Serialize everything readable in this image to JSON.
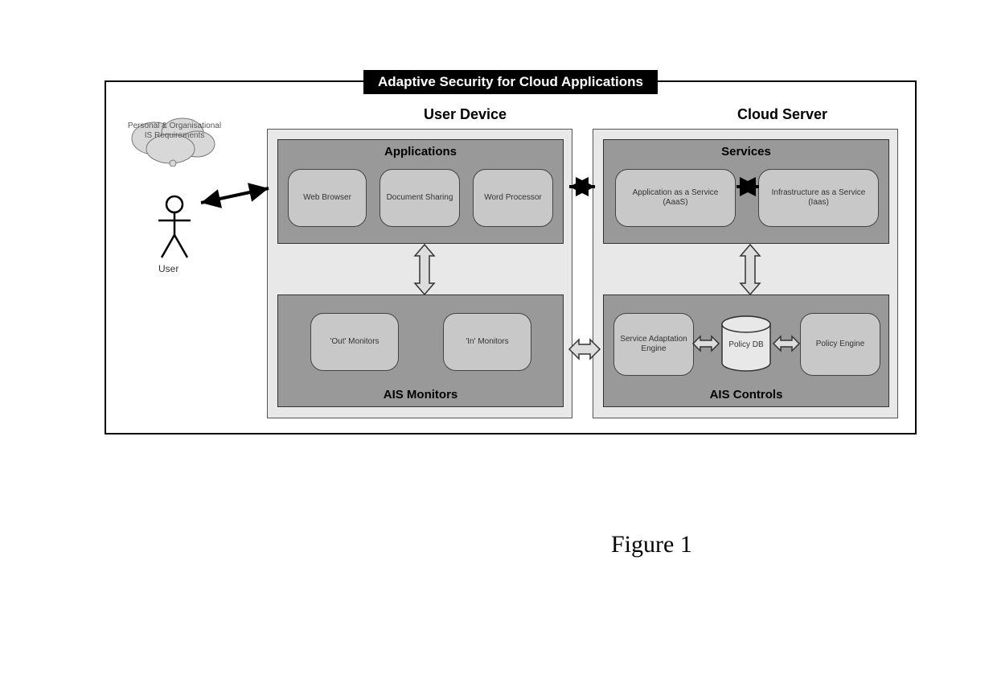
{
  "title": "Adaptive Security for Cloud Applications",
  "columns": {
    "user_device": "User Device",
    "cloud_server": "Cloud Server"
  },
  "user": {
    "label": "User",
    "bubble": "Personal & Organisational IS Requirements"
  },
  "user_device": {
    "applications": {
      "title": "Applications",
      "items": [
        "Web Browser",
        "Document Sharing",
        "Word Processor"
      ]
    },
    "monitors": {
      "title": "AIS Monitors",
      "items": [
        "'Out' Monitors",
        "'In' Monitors"
      ]
    }
  },
  "cloud_server": {
    "services": {
      "title": "Services",
      "items": [
        "Application as a Service (AaaS)",
        "Infrastructure as a Service (Iaas)"
      ]
    },
    "controls": {
      "title": "AIS Controls",
      "sae": "Service Adaptation Engine",
      "db": "Policy DB",
      "pe": "Policy Engine"
    }
  },
  "caption": "Figure 1"
}
